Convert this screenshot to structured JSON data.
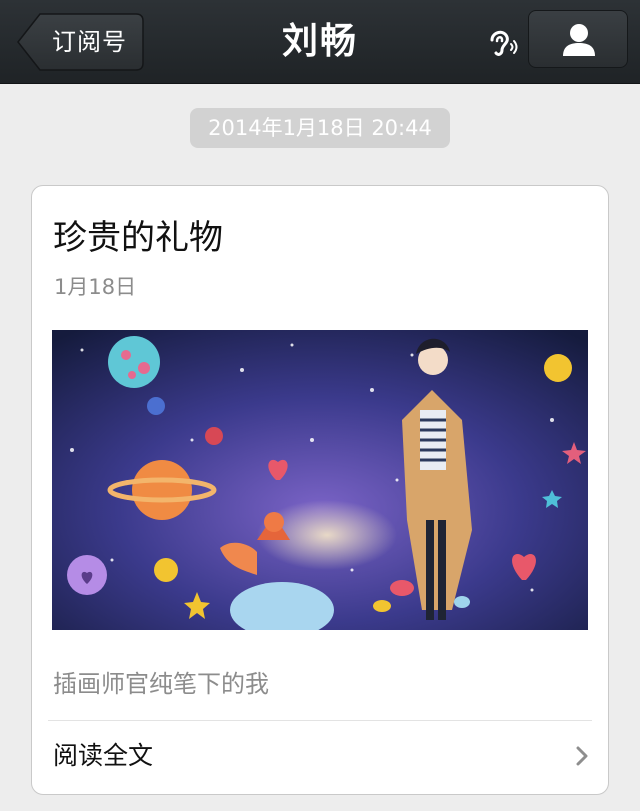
{
  "navbar": {
    "back_label": "订阅号",
    "title": "刘畅",
    "ear_icon": "ear-icon",
    "profile_icon": "person-icon"
  },
  "message": {
    "timestamp": "2014年1月18日 20:44"
  },
  "article": {
    "title": "珍贵的礼物",
    "date": "1月18日",
    "cover_image": "space-illustration-boy-fox",
    "description": "插画师官纯笔下的我",
    "read_more_label": "阅读全文",
    "read_more_icon": "chevron-right-icon"
  },
  "colors": {
    "navbar_bg": "#24282b",
    "page_bg": "#ededed",
    "timestamp_bg": "#d2d2d2",
    "secondary_text": "#8c8c8c"
  }
}
